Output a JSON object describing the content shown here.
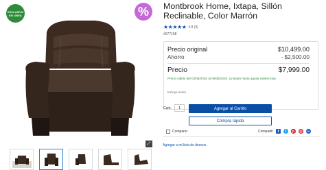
{
  "badges": {
    "online": "EXCLUSIVO EN LÍNEA",
    "percent": "%"
  },
  "product": {
    "title": "Montbrook Home, Ixtapa, Sillón Reclinable, Color Marrón",
    "stars": "★★★★★",
    "rating_text": "4.8 (9)",
    "sku": "#677168"
  },
  "pricing": {
    "original_label": "Precio original",
    "original_value": "$10,499.00",
    "ahorro_label": "Ahorro",
    "ahorro_value": "- $2,500.00",
    "precio_label": "Precio",
    "precio_value": "$7,999.00",
    "validity": "Precio válido del 03/08/2026 al 09/08/2026. Limitado hasta agotar existencias.",
    "shipping": "Incluye envío"
  },
  "actions": {
    "qty_label": "Cant.",
    "qty_value": "1",
    "add_to_cart": "Agregar al Carrito",
    "quick_buy": "Compra rápida",
    "compare": "Comparar",
    "share": "Compartir",
    "wishlist": "Agregar a mi lista de deseos"
  },
  "social": {
    "facebook": "f",
    "twitter": "t",
    "pinterest": "p",
    "email": "@",
    "link": "∞"
  },
  "colors": {
    "brand_blue": "#0a4fa6",
    "green": "#2e8b3a",
    "purple": "#c46ad8"
  }
}
